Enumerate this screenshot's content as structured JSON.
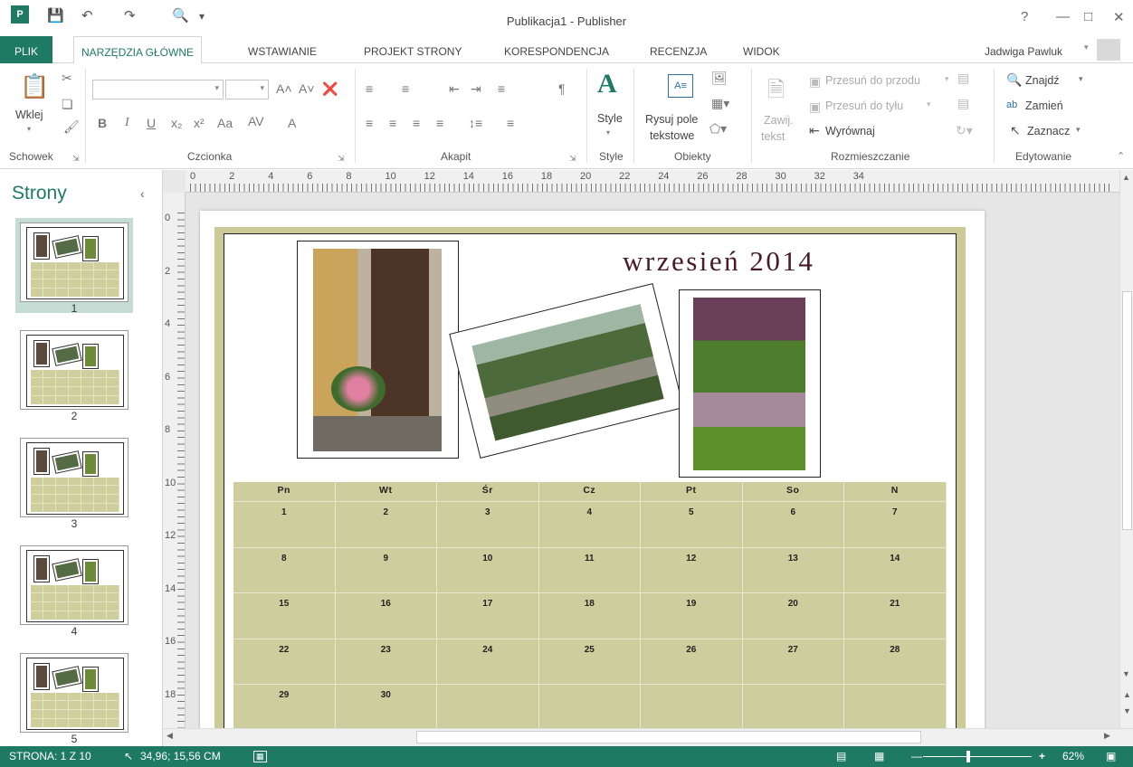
{
  "window": {
    "title": "Publikacja1 - Publisher",
    "user": "Jadwiga Pawluk",
    "help": "?"
  },
  "tabs": [
    {
      "label": "PLIK"
    },
    {
      "label": "NARZĘDZIA GŁÓWNE"
    },
    {
      "label": "WSTAWIANIE"
    },
    {
      "label": "PROJEKT STRONY"
    },
    {
      "label": "KORESPONDENCJA"
    },
    {
      "label": "RECENZJA"
    },
    {
      "label": "WIDOK"
    }
  ],
  "ribbon": {
    "groups": {
      "clipboard": "Schowek",
      "font": "Czcionka",
      "paragraph": "Akapit",
      "styles": "Style",
      "objects": "Obiekty",
      "arrange": "Rozmieszczanie",
      "editing": "Edytowanie"
    },
    "paste": "Wklej",
    "style": "Style",
    "draw_textbox": "Rysuj pole",
    "draw_textbox2": "tekstowe",
    "wrap_text": "Zawij.",
    "wrap_text2": "tekst",
    "bring_forward": "Przesuń do przodu",
    "send_backward": "Przesuń do tyłu",
    "align": "Wyrównaj",
    "find": "Znajdź",
    "replace": "Zamień",
    "select": "Zaznacz",
    "font_name": "",
    "font_size": "",
    "case": "Aa"
  },
  "pages_panel": {
    "title": "Strony",
    "pages": [
      "1",
      "2",
      "3",
      "4",
      "5"
    ],
    "selected": 1
  },
  "ruler": {
    "h": [
      "0",
      "2",
      "4",
      "6",
      "8",
      "10",
      "12",
      "14",
      "16",
      "18",
      "20",
      "22",
      "24",
      "26",
      "28",
      "30",
      "32",
      "34"
    ],
    "v": [
      "0",
      "2",
      "4",
      "6",
      "8",
      "10",
      "12",
      "14",
      "16",
      "18"
    ]
  },
  "calendar": {
    "month": "wrzesień 2014",
    "days": [
      "Pn",
      "Wt",
      "Śr",
      "Cz",
      "Pt",
      "So",
      "N"
    ],
    "weeks": [
      [
        "1",
        "2",
        "3",
        "4",
        "5",
        "6",
        "7"
      ],
      [
        "8",
        "9",
        "10",
        "11",
        "12",
        "13",
        "14"
      ],
      [
        "15",
        "16",
        "17",
        "18",
        "19",
        "20",
        "21"
      ],
      [
        "22",
        "23",
        "24",
        "25",
        "26",
        "27",
        "28"
      ],
      [
        "29",
        "30",
        "",
        "",
        "",
        "",
        ""
      ]
    ]
  },
  "status": {
    "page": "STRONA: 1 Z 10",
    "position": "34,96; 15,56 CM",
    "zoom": "62%"
  },
  "colors": {
    "accent": "#1f7a63",
    "calendar_fill": "#cdcd9d",
    "title_color": "#4a1a2a"
  }
}
